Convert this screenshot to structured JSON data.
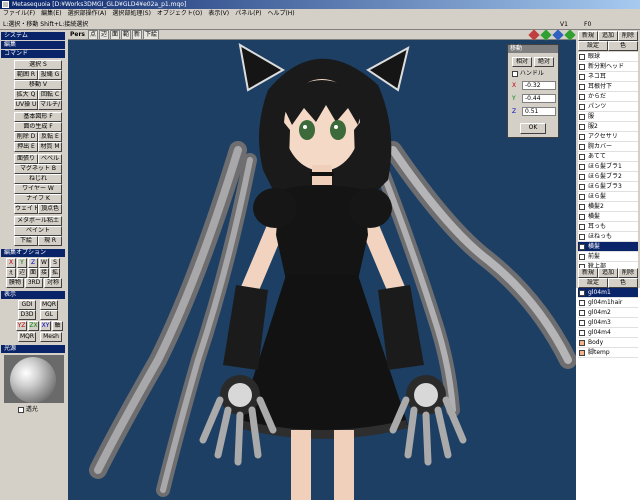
{
  "window": {
    "title": "Metasequoia [D:¥Works3DMGI_GLD¥GLD4¥e02a_p1.mqo]"
  },
  "menu": [
    "ファイル(F)",
    "編集(E)",
    "選択部操作(A)",
    "選択部処理(S)",
    "オブジェクト(O)",
    "表示(V)",
    "パネル(P)",
    "ヘルプ(H)"
  ],
  "status": {
    "text": "L:選択・移動  Shift+L:接続選択",
    "v": "V1",
    "f": "F0"
  },
  "left_panel": {
    "system_header": "システム",
    "edit_header": "編集",
    "command_header": "コマンド",
    "commands": [
      [
        "選択 S"
      ],
      [
        "範囲 R",
        "投縄 G"
      ],
      [
        "移動 V"
      ],
      [
        "拡大 Q",
        "回転 C"
      ],
      [
        "UV操 U",
        "マルチ/"
      ],
      [
        "基本図形 F"
      ],
      [
        "面の生成 F"
      ],
      [
        "削除 D",
        "反転 E"
      ],
      [
        "押出 E",
        "材質 M"
      ],
      [
        "面張り",
        "ベベル"
      ],
      [
        "マグネット B"
      ],
      [
        "ねじれ"
      ],
      [
        "ワイヤー W"
      ],
      [
        "ナイフ K"
      ],
      [
        "ウェイト",
        "頂点色"
      ],
      [
        "メタボール粘土"
      ],
      [
        "ペイント"
      ],
      [
        "下絵",
        "現 R"
      ]
    ],
    "edit_option_header": "編集オプション",
    "axis_buttons": [
      "X",
      "Y",
      "Z",
      "W",
      "S"
    ],
    "option_buttons": [
      "ぇ",
      "辺",
      "面",
      "接",
      "拡"
    ],
    "option_buttons2": [
      "膜物",
      "3RD",
      "対称"
    ],
    "display_header": "表示",
    "display_rows": [
      [
        "GDI",
        "MQR"
      ],
      [
        "D3D",
        "GL"
      ],
      [
        "YZ",
        "ZX",
        "XY",
        "軸"
      ],
      [
        "MQR",
        "Mesh"
      ]
    ],
    "light_header": "光源",
    "light_checkbox": "透光"
  },
  "viewport_toolbar": {
    "mode": "Pers",
    "buttons": [
      "点",
      "辺",
      "面",
      "範",
      "新"
    ],
    "label": "下絵"
  },
  "dialog": {
    "title": "移動",
    "tabs": [
      "相対",
      "絶対"
    ],
    "checkbox": "ハンドル",
    "x_label": "X",
    "x_value": "-0.32",
    "y_label": "Y",
    "y_value": "-0.44",
    "z_label": "Z",
    "z_value": "0.51",
    "ok": "OK"
  },
  "right_panel": {
    "top_buttons": [
      "新規",
      "追加",
      "削除",
      "設定",
      "色"
    ],
    "materials": [
      "眼球",
      "新分割ヘッド",
      "ネコ耳",
      "耳根付下",
      "からだ",
      "パンツ",
      "服",
      "服2",
      "アクセサリ",
      "腕カバー",
      "あてて",
      "ほら髪ブラ1",
      "ほら髪ブラ2",
      "ほら髪ブラ3",
      "ほら髪",
      "横髪2",
      "横髪",
      "耳っも",
      "ほねっも",
      "横髪",
      "前髪",
      "靴上部"
    ],
    "selected_material": 19,
    "bottom_buttons": [
      "新規",
      "追加",
      "削除",
      "設定",
      "色"
    ],
    "objects": [
      "gl04m1",
      "gl04m1hair",
      "gl04m2",
      "gl04m3",
      "gl04m4",
      "Body",
      "脚temp"
    ],
    "selected_object": 0
  },
  "colors": {
    "viewport_bg": "#1d3f64",
    "selection": "#0a246a"
  }
}
